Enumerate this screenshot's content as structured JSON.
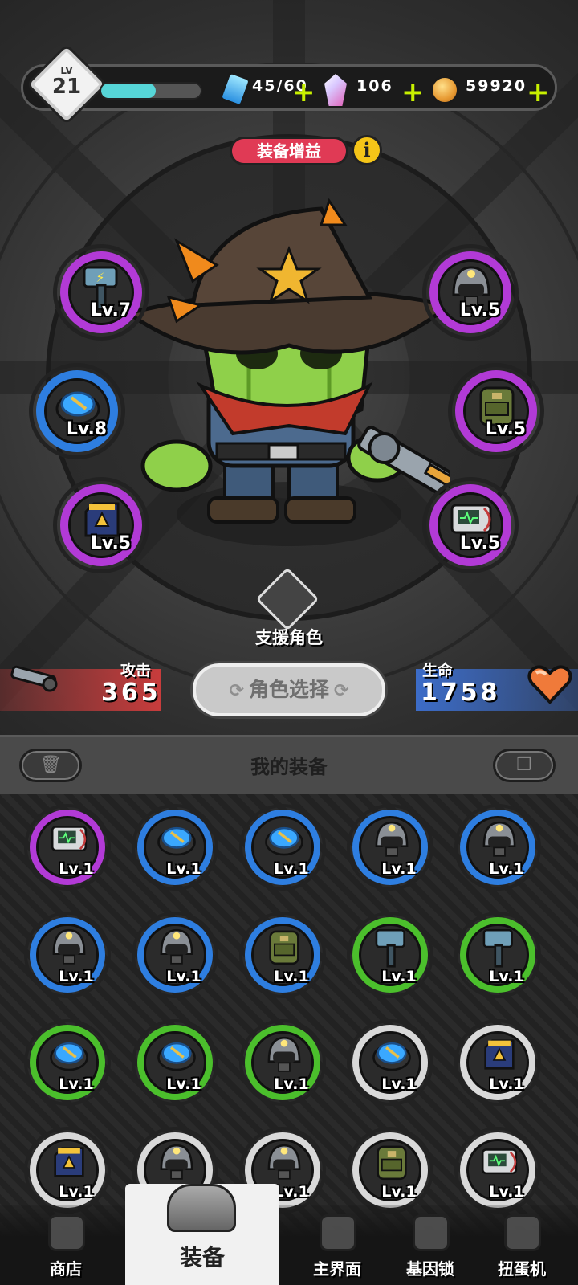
{
  "player": {
    "level_label": "LV",
    "level": "21",
    "xp_progress": 0.55
  },
  "resources": {
    "energy": "45/60",
    "crystals": "106",
    "coins": "59920",
    "add_symbol": "+"
  },
  "stage": {
    "bonus_label": "装备增益",
    "info_symbol": "i",
    "support_label": "支援角色",
    "character_select": "角色选择",
    "rotate_symbol": "⟳"
  },
  "stats": {
    "attack_label": "攻击",
    "attack_value": "365",
    "hp_label": "生命",
    "hp_value": "1758"
  },
  "equipped": [
    {
      "name": "hammer",
      "rarity": "purple",
      "level": "Lv.7"
    },
    {
      "name": "helmet",
      "rarity": "purple",
      "level": "Lv.5"
    },
    {
      "name": "shield-disc",
      "rarity": "blue",
      "level": "Lv.8"
    },
    {
      "name": "backpack",
      "rarity": "purple",
      "level": "Lv.5"
    },
    {
      "name": "gauntlet",
      "rarity": "purple",
      "level": "Lv.5"
    },
    {
      "name": "medkit",
      "rarity": "purple",
      "level": "Lv.5"
    }
  ],
  "inventory": {
    "title": "我的装备",
    "trash_symbol": "🗑",
    "copy_symbol": "❐",
    "items": [
      {
        "name": "medkit",
        "rarity": "purple",
        "level": "Lv.1"
      },
      {
        "name": "shield-disc",
        "rarity": "blue",
        "level": "Lv.1"
      },
      {
        "name": "shield-disc",
        "rarity": "blue",
        "level": "Lv.1"
      },
      {
        "name": "helmet",
        "rarity": "blue",
        "level": "Lv.1"
      },
      {
        "name": "helmet",
        "rarity": "blue",
        "level": "Lv.1"
      },
      {
        "name": "helmet",
        "rarity": "blue",
        "level": "Lv.1"
      },
      {
        "name": "helmet",
        "rarity": "blue",
        "level": "Lv.1"
      },
      {
        "name": "backpack",
        "rarity": "blue",
        "level": "Lv.1"
      },
      {
        "name": "hammer",
        "rarity": "green",
        "level": "Lv.1"
      },
      {
        "name": "hammer",
        "rarity": "green",
        "level": "Lv.1"
      },
      {
        "name": "shield-disc",
        "rarity": "green",
        "level": "Lv.1"
      },
      {
        "name": "shield-disc",
        "rarity": "green",
        "level": "Lv.1"
      },
      {
        "name": "helmet",
        "rarity": "green",
        "level": "Lv.1"
      },
      {
        "name": "shield-disc",
        "rarity": "white",
        "level": "Lv.1"
      },
      {
        "name": "gauntlet",
        "rarity": "white",
        "level": "Lv.1"
      },
      {
        "name": "gauntlet",
        "rarity": "white",
        "level": "Lv.1"
      },
      {
        "name": "helmet",
        "rarity": "white",
        "level": "Lv.1"
      },
      {
        "name": "helmet",
        "rarity": "white",
        "level": "Lv.1"
      },
      {
        "name": "backpack",
        "rarity": "white",
        "level": "Lv.1"
      },
      {
        "name": "medkit",
        "rarity": "white",
        "level": "Lv.1"
      }
    ]
  },
  "nav": {
    "shop": "商店",
    "equipment": "装备",
    "main": "主界面",
    "gene_lock": "基因锁",
    "gacha": "扭蛋机"
  },
  "colors": {
    "purple": "#b23ad6",
    "blue": "#2e7ee0",
    "green": "#4bbf2c",
    "white": "#d9d9d9",
    "accent_pink": "#e03a55",
    "plus_green": "#c8f000"
  }
}
